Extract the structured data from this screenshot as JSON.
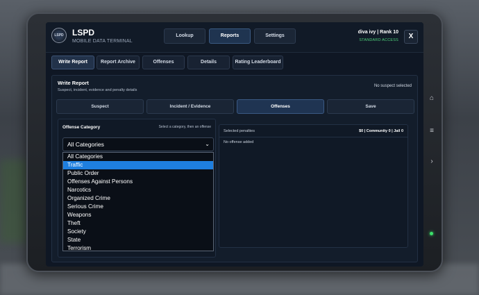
{
  "header": {
    "brand": "LSPD",
    "subtitle": "MOBILE DATA TERMINAL",
    "nav": [
      "Lookup",
      "Reports",
      "Settings"
    ],
    "active_nav": "Reports",
    "user": "diva ivy | Rank 10",
    "access": "STANDARD ACCESS",
    "close_label": "X",
    "logo_text": "LSPD"
  },
  "tabs": [
    "Write Report",
    "Report Archive",
    "Offenses",
    "Details",
    "Rating Leaderboard"
  ],
  "panel": {
    "title": "Write Report",
    "subtitle": "Suspect, incident, evidence and penalty details",
    "suspect_status": "No suspect selected",
    "steps": [
      "Suspect",
      "Incident / Evidence",
      "Offenses",
      "Save"
    ]
  },
  "offense_category": {
    "label": "Offense Category",
    "hint": "Select a category, then an offense",
    "selected": "All Categories",
    "highlighted": "Traffic",
    "options": [
      "All Categories",
      "Traffic",
      "Public Order",
      "Offenses Against Persons",
      "Narcotics",
      "Organized Crime",
      "Serious Crime",
      "Weapons",
      "Theft",
      "Society",
      "State",
      "Terrorism"
    ]
  },
  "penalties": {
    "label": "Selected penalties",
    "totals": "$0 | Community 0 | Jail 0",
    "empty": "No offense added"
  },
  "icons": {
    "close": "close-icon",
    "chevron": "chevron-down-icon",
    "tablet_buttons": [
      "home-icon",
      "menu-icon",
      "chevron-right-icon"
    ]
  },
  "colors": {
    "accent": "#1e7fe0",
    "access_green": "#4ed17a",
    "screen_bg": "#0f1724"
  }
}
